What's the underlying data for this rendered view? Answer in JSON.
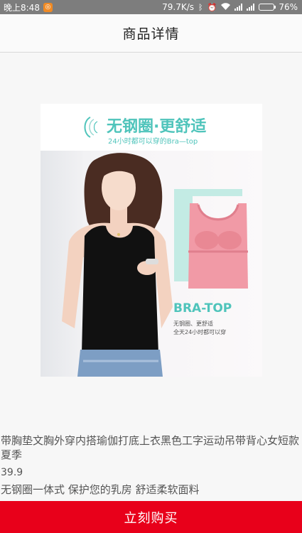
{
  "status_bar": {
    "time": "晚上8:48",
    "app_icon": "notification-app-icon",
    "network_speed": "79.7K/s",
    "battery_percent": "76%",
    "battery_level": 0.76,
    "icons": [
      "bluetooth-icon",
      "alarm-icon",
      "wifi-icon",
      "signal-icon",
      "battery-icon"
    ]
  },
  "header": {
    "title": "商品详情"
  },
  "product_image": {
    "slogan": "无钢圈·更舒适",
    "slogan_sub": "24小时都可以穿的Bra—top",
    "callout_title": "BRA-TOP",
    "callout_lines": [
      "无钢圈、更舒适",
      "全天24小时都可以穿"
    ],
    "colors": {
      "accent": "#4fc4bb",
      "frame": "#c3ebe4",
      "garment_pink": "#f19aa6",
      "garment_black": "#111111"
    }
  },
  "product": {
    "title": "带胸垫文胸外穿内搭瑜伽打底上衣黑色工字运动吊带背心女短款夏季",
    "price": "39.9",
    "description": "无钢圈一体式 保护您的乳房 舒适柔软面料"
  },
  "buy_button": {
    "label": "立刻购买",
    "color": "#e8001a"
  }
}
